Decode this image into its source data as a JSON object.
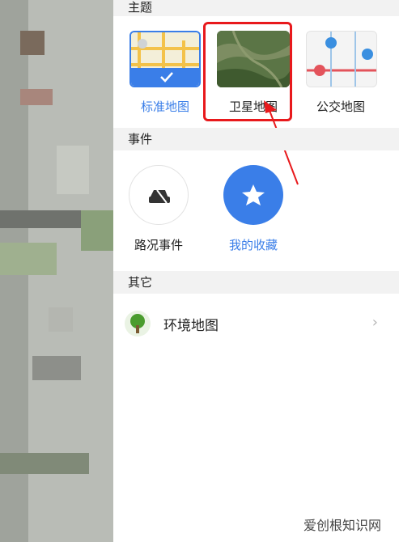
{
  "sections": {
    "theme": {
      "title": "主题",
      "items": [
        {
          "label": "标准地图",
          "selected": true,
          "label_color": "#3a7ee8"
        },
        {
          "label": "卫星地图",
          "selected": false,
          "label_color": "#222222"
        },
        {
          "label": "公交地图",
          "selected": false,
          "label_color": "#222222"
        }
      ]
    },
    "events": {
      "title": "事件",
      "items": [
        {
          "label": "路况事件",
          "icon": "car-icon",
          "label_color": "#222222"
        },
        {
          "label": "我的收藏",
          "icon": "star-icon",
          "label_color": "#3a7ee8",
          "active": true
        }
      ]
    },
    "other": {
      "title": "其它",
      "items": [
        {
          "label": "环境地图",
          "icon": "tree-icon"
        }
      ]
    }
  },
  "watermark": "爱创根知识网",
  "colors": {
    "accent": "#3a7ee8",
    "highlight": "#e8191c"
  }
}
